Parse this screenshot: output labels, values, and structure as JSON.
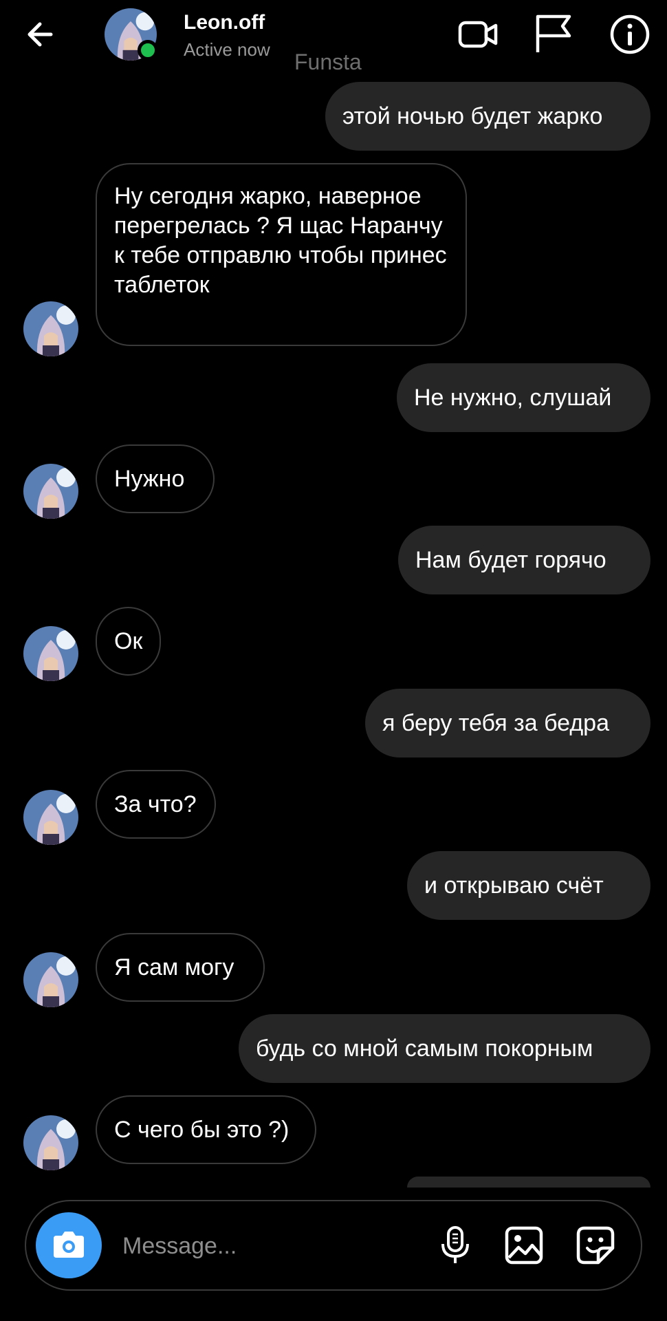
{
  "header": {
    "name": "Leon.off",
    "status": "Active now",
    "subtitle": "Funsta",
    "icons": [
      "back-arrow-icon",
      "video-call-icon",
      "flag-icon",
      "info-icon"
    ],
    "online_color": "#1fbf4f"
  },
  "messages": [
    {
      "side": "sent",
      "text": "этой ночью будет жарко"
    },
    {
      "side": "received",
      "text": "Ну сегодня жарко, наверное перегрелась ? Я щас Наранчу к тебе отправлю чтобы принес таблеток"
    },
    {
      "side": "sent",
      "text": "Не нужно, слушай"
    },
    {
      "side": "received",
      "text": "Нужно"
    },
    {
      "side": "sent",
      "text": "Нам будет горячо"
    },
    {
      "side": "received",
      "text": "Ок"
    },
    {
      "side": "sent",
      "text": "я беру тебя за бедра"
    },
    {
      "side": "received",
      "text": "За что?"
    },
    {
      "side": "sent",
      "text": "и открываю счёт"
    },
    {
      "side": "received",
      "text": "Я сам могу"
    },
    {
      "side": "sent",
      "text": "будь со мной самым покорным"
    },
    {
      "side": "received",
      "text": "С чего бы это ?)"
    }
  ],
  "composer": {
    "placeholder": "Message...",
    "icons": [
      "camera-icon",
      "microphone-icon",
      "gallery-icon",
      "sticker-icon"
    ],
    "camera_color": "#3b9cf6"
  }
}
